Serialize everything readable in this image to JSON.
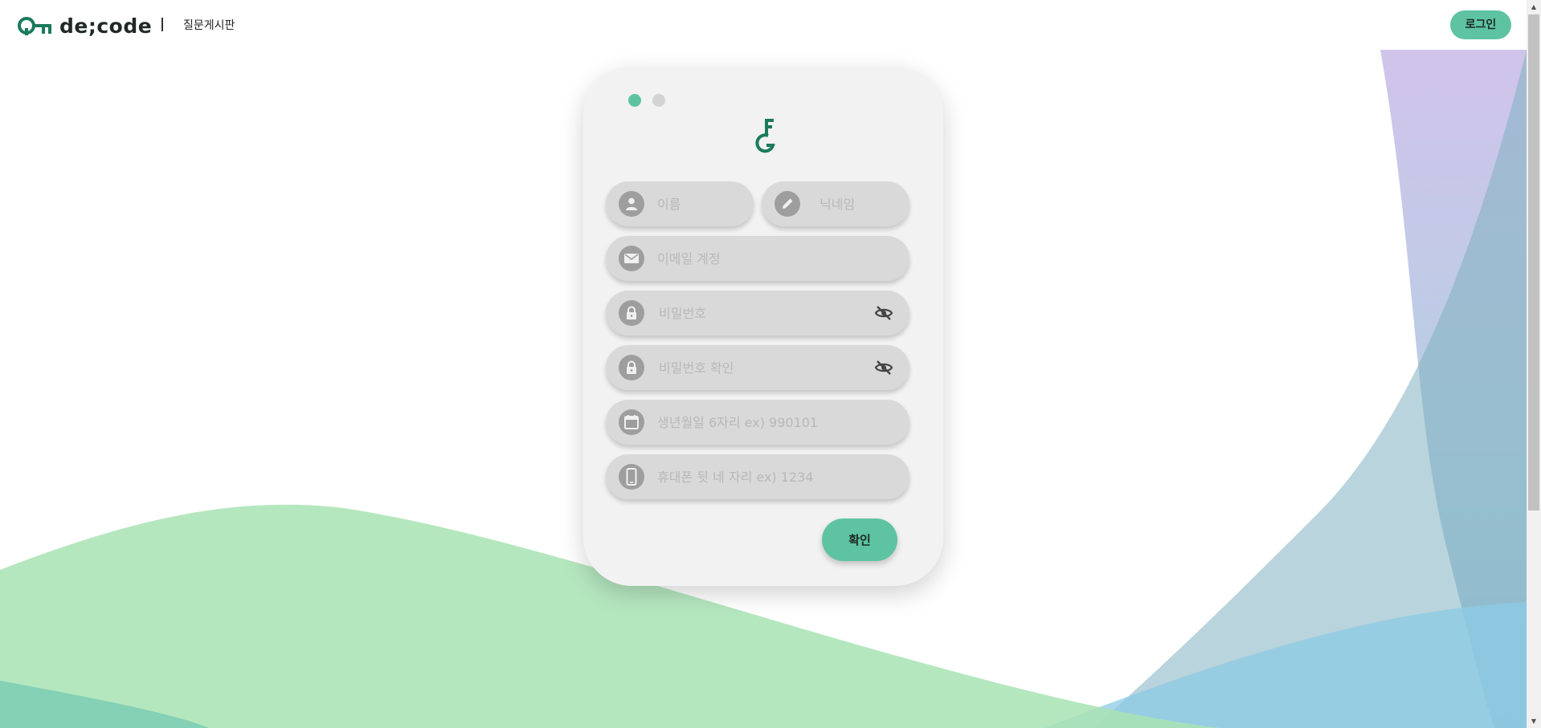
{
  "header": {
    "logo_text": "de;code",
    "board_link": "질문게시판",
    "login_label": "로그인"
  },
  "form": {
    "step_dots": [
      "active",
      "inactive"
    ],
    "fields": {
      "name": {
        "placeholder": "이름",
        "icon": "person-icon"
      },
      "nickname": {
        "placeholder": "닉네임",
        "icon": "pencil-icon"
      },
      "email": {
        "placeholder": "이메일 계정",
        "icon": "mail-icon"
      },
      "password": {
        "placeholder": "비밀번호",
        "icon": "lock-icon",
        "toggle_icon": "eye-off-icon"
      },
      "password_confirm": {
        "placeholder": "비밀번호 확인",
        "icon": "lock-icon",
        "toggle_icon": "eye-off-icon"
      },
      "birthdate": {
        "placeholder": "생년월일 6자리 ex) 990101",
        "icon": "calendar-icon"
      },
      "phone": {
        "placeholder": "휴대폰 뒷 네 자리 ex) 1234",
        "icon": "phone-icon"
      }
    },
    "confirm_label": "확인"
  },
  "colors": {
    "accent": "#5ec3a2",
    "brand": "#1a7a5c",
    "field_bg": "#d9d9d9",
    "icon_bg": "#9e9e9e",
    "card_bg": "#f2f2f2"
  }
}
